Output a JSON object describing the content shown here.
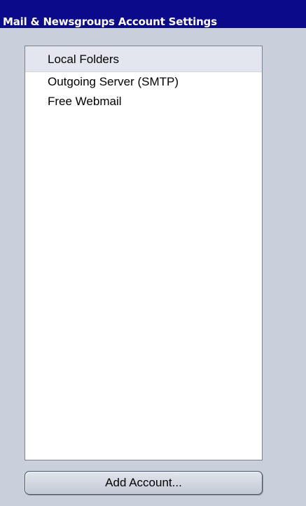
{
  "window": {
    "title": "Mail & Newsgroups Account Settings"
  },
  "accounts": {
    "items": [
      {
        "label": "Local Folders",
        "selected": true
      },
      {
        "label": "Outgoing Server (SMTP)",
        "selected": false
      },
      {
        "label": "Free Webmail",
        "selected": false
      }
    ]
  },
  "buttons": {
    "add_account": "Add Account..."
  },
  "colors": {
    "title_bar": "#0a0a8a",
    "background": "#c9d0dc",
    "selected_row": "#e3e6ee"
  }
}
